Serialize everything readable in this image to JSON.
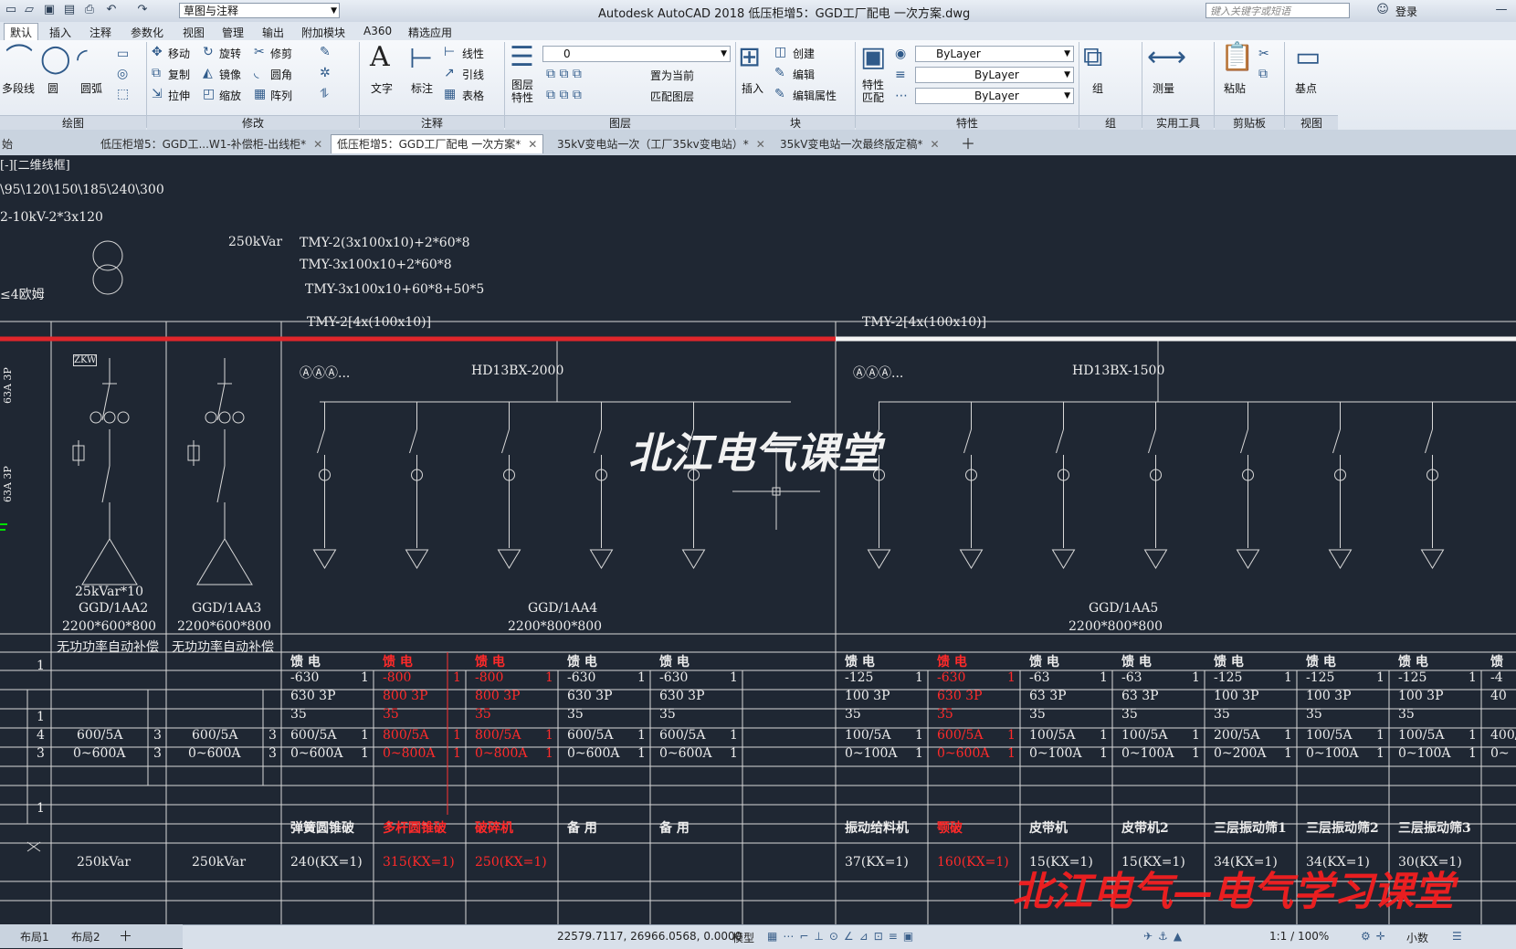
{
  "titlebar": {
    "workspace": "草图与注释",
    "title": "Autodesk AutoCAD 2018    低压柜增5：GGD工厂配电 一次方案.dwg",
    "search_placeholder": "键入关键字或短语",
    "login": "登录"
  },
  "ribbon_tabs": [
    "默认",
    "插入",
    "注释",
    "参数化",
    "视图",
    "管理",
    "输出",
    "附加模块",
    "A360",
    "精选应用"
  ],
  "ribbon": {
    "draw": {
      "polyline": "多段线",
      "circle": "圆",
      "arc": "圆弧",
      "panel": "绘图"
    },
    "modify": {
      "move": "移动",
      "rotate": "旋转",
      "trim": "修剪",
      "copy": "复制",
      "mirror": "镜像",
      "fillet": "圆角",
      "stretch": "拉伸",
      "scale": "缩放",
      "array": "阵列",
      "panel": "修改"
    },
    "annotation": {
      "text": "文字",
      "dim": "标注",
      "linear": "线性",
      "leader": "引线",
      "table": "表格",
      "panel": "注释"
    },
    "layers": {
      "props": "图层\n特性",
      "layer_value": "0",
      "set_current": "置为当前",
      "match_layer": "匹配图层",
      "panel": "图层"
    },
    "block": {
      "insert": "插入",
      "create": "创建",
      "edit": "编辑",
      "edit_attr": "编辑属性",
      "panel": "块"
    },
    "properties": {
      "match": "特性\n匹配",
      "bylayer1": "ByLayer",
      "bylayer2": "ByLayer",
      "bylayer3": "ByLayer",
      "panel": "特性"
    },
    "groups": {
      "group": "组",
      "panel": "组"
    },
    "utilities": {
      "measure": "测量",
      "panel": "实用工具"
    },
    "clipboard": {
      "paste": "粘贴",
      "panel": "剪贴板"
    },
    "view": {
      "base": "基点",
      "panel": "视图"
    }
  },
  "doc_tabs": [
    {
      "label": "始"
    },
    {
      "label": "低压柜增5：GGD工...W1-补偿柜-出线柜*"
    },
    {
      "label": "低压柜增5：GGD工厂配电 一次方案*"
    },
    {
      "label": "35kV变电站一次（工厂35kv变电站）*"
    },
    {
      "label": "35kV变电站一次最终版定稿*"
    }
  ],
  "drawing": {
    "viewport_label": "[-][二维线框]",
    "cable_sizes": "\\95\\120\\150\\185\\240\\300",
    "cable_type": "2-10kV-2*3x120",
    "kvar": "250kVar",
    "busbar_1": "TMY-2(3x100x10)+2*60*8",
    "busbar_2": "TMY-3x100x10+2*60*8",
    "busbar_3": "TMY-3x100x10+60*8+50*5",
    "ohm": "≤4欧姆",
    "bus_left": "TMY-2[4x(100x10)]",
    "bus_right": "TMY-2[4x(100x10)]",
    "ammeters": "ⒶⒶⒶ...",
    "switch_left": "HD13BX-2000",
    "switch_right": "HD13BX-1500",
    "cap_rating": "25kVar*10",
    "side_63": "63A 3P",
    "side_63b": "63A 3P",
    "zkw": "ZKW",
    "cabinets": [
      {
        "id": "GGD/1AA2",
        "size": "2200*600*800",
        "func": "无功功率自动补偿",
        "ct": "600/5A",
        "meter": "0~600A",
        "load": "250kVar",
        "ct_n": "3",
        "meter_n": "3"
      },
      {
        "id": "GGD/1AA3",
        "size": "2200*600*800",
        "func": "无功功率自动补偿",
        "ct": "600/5A",
        "meter": "0~600A",
        "load": "250kVar",
        "ct_n": "3",
        "meter_n": "3"
      },
      {
        "id": "GGD/1AA4",
        "size": "2200*800*800"
      },
      {
        "id": "GGD/1AA5",
        "size": "2200*800*800"
      }
    ],
    "feeders": [
      {
        "name": "馈 电",
        "breaker": "-630",
        "frame": "630 3P",
        "wire": "35",
        "ct": "600/5A",
        "meter": "0~600A",
        "load": "弹簧圆锥破",
        "kw": "240(KX=1)",
        "red": false
      },
      {
        "name": "馈 电",
        "breaker": "-800",
        "frame": "800 3P",
        "wire": "35",
        "ct": "800/5A",
        "meter": "0~800A",
        "load": "多杆圆锥破",
        "kw": "315(KX=1)",
        "red": true
      },
      {
        "name": "馈 电",
        "breaker": "-800",
        "frame": "800 3P",
        "wire": "35",
        "ct": "800/5A",
        "meter": "0~800A",
        "load": "破碎机",
        "kw": "250(KX=1)",
        "red": true
      },
      {
        "name": "馈 电",
        "breaker": "-630",
        "frame": "630 3P",
        "wire": "35",
        "ct": "600/5A",
        "meter": "0~600A",
        "load": "备 用",
        "kw": "",
        "red": false
      },
      {
        "name": "馈 电",
        "breaker": "-630",
        "frame": "630 3P",
        "wire": "35",
        "ct": "600/5A",
        "meter": "0~600A",
        "load": "备 用",
        "kw": "",
        "red": false
      },
      {
        "name": "馈 电",
        "breaker": "-125",
        "frame": "100 3P",
        "wire": "35",
        "ct": "100/5A",
        "meter": "0~100A",
        "load": "振动给料机",
        "kw": "37(KX=1)",
        "red": false
      },
      {
        "name": "馈 电",
        "breaker": "-630",
        "frame": "630 3P",
        "wire": "35",
        "ct": "600/5A",
        "meter": "0~600A",
        "load": "颚破",
        "kw": "160(KX=1)",
        "red": true
      },
      {
        "name": "馈 电",
        "breaker": "-63",
        "frame": "63 3P",
        "wire": "35",
        "ct": "100/5A",
        "meter": "0~100A",
        "load": "皮带机",
        "kw": "15(KX=1)",
        "red": false
      },
      {
        "name": "馈 电",
        "breaker": "-63",
        "frame": "63 3P",
        "wire": "35",
        "ct": "100/5A",
        "meter": "0~100A",
        "load": "皮带机2",
        "kw": "15(KX=1)",
        "red": false
      },
      {
        "name": "馈 电",
        "breaker": "-125",
        "frame": "100 3P",
        "wire": "35",
        "ct": "200/5A",
        "meter": "0~200A",
        "load": "三层振动筛1",
        "kw": "34(KX=1)",
        "red": false
      },
      {
        "name": "馈 电",
        "breaker": "-125",
        "frame": "100 3P",
        "wire": "35",
        "ct": "100/5A",
        "meter": "0~100A",
        "load": "三层振动筛2",
        "kw": "34(KX=1)",
        "red": false
      },
      {
        "name": "馈 电",
        "breaker": "-125",
        "frame": "100 3P",
        "wire": "35",
        "ct": "100/5A",
        "meter": "0~100A",
        "load": "三层振动筛3",
        "kw": "30(KX=1)",
        "red": false
      },
      {
        "name": "馈",
        "breaker": "-4",
        "frame": "40",
        "wire": "",
        "ct": "400/",
        "meter": "0~",
        "load": "",
        "kw": "",
        "red": false
      }
    ],
    "qty": [
      "1",
      "1",
      "1",
      "1",
      "1",
      "1",
      "1",
      "1",
      "1",
      "1",
      "1",
      "1",
      "1"
    ],
    "left_col": {
      "q1": "1",
      "q2": "1",
      "q3": "4",
      "q4": "3",
      "q5": "1"
    },
    "watermark": "北江电气课堂",
    "watermark2": "北江电气—电气学习课堂"
  },
  "layout_tabs": [
    "布局1",
    "布局2"
  ],
  "status": {
    "coords": "22579.7117, 26966.0568, 0.0000",
    "model": "模型",
    "scale": "1:1 / 100%",
    "units": "小数"
  }
}
